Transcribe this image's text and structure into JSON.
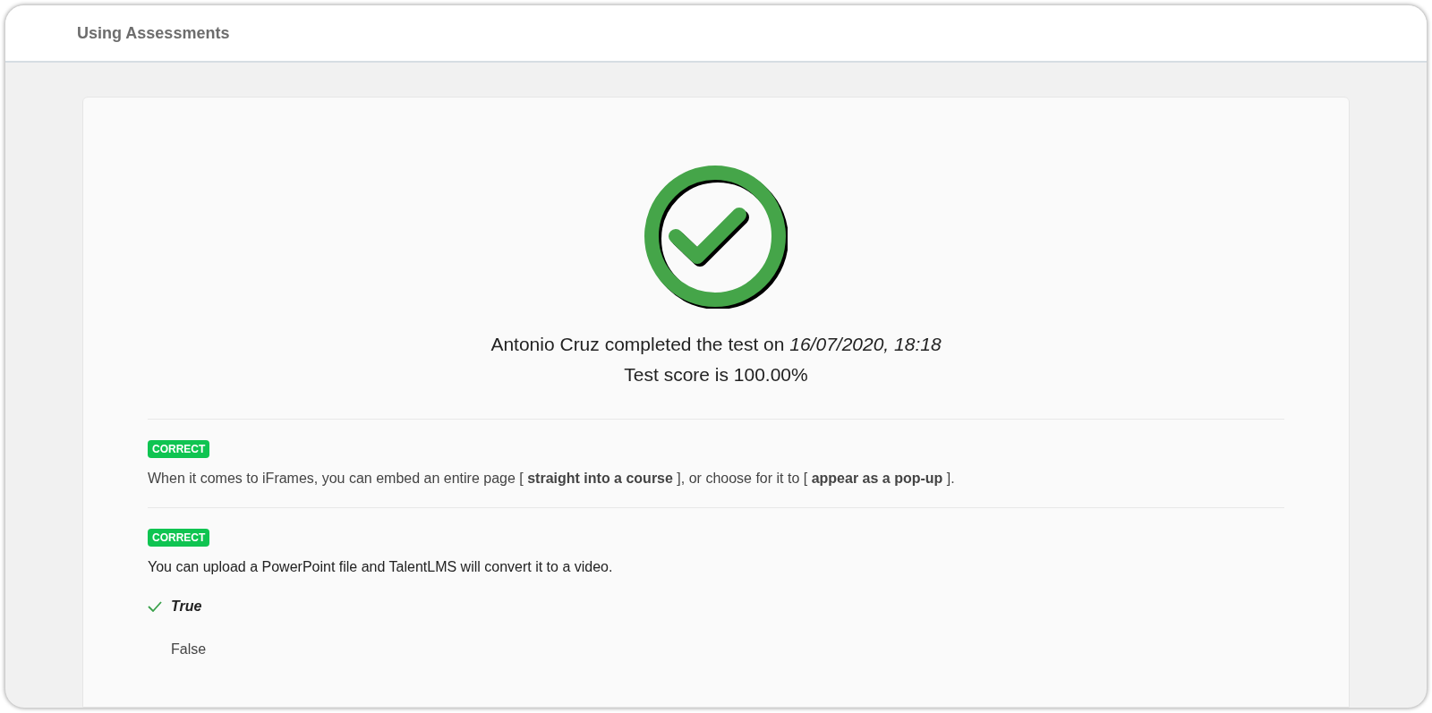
{
  "page": {
    "title": "Using Assessments"
  },
  "result": {
    "passed": true,
    "summary": "Antonio Cruz completed the test on *16/07/2020, 18:18*",
    "score": "Test score is 100.00%"
  },
  "questions": [
    {
      "kind": "fill_blank",
      "badge": "CORRECT",
      "correct": true,
      "text": "When it comes to iFrames, you can embed an entire page [ **straight into a course** ], or choose for it to [ **appear as a pop-up** ]."
    },
    {
      "kind": "true_false",
      "badge": "CORRECT",
      "correct": true,
      "text": "You can upload a PowerPoint file and TalentLMS will convert it to a video.",
      "options": [
        {
          "label": "True",
          "selected": true
        },
        {
          "label": "False",
          "selected": false
        }
      ]
    }
  ]
}
